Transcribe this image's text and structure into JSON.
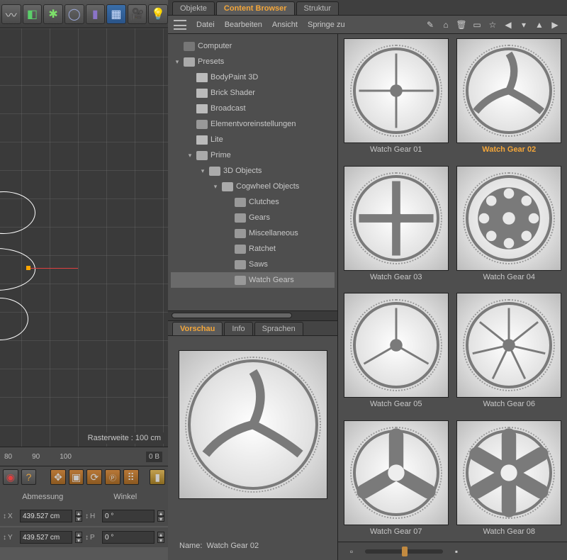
{
  "toolbar_icons": [
    "extrude",
    "cube",
    "flower",
    "shell",
    "deformer",
    "grid",
    "camera",
    "light"
  ],
  "viewport": {
    "raster_label": "Rasterweite : 100 cm"
  },
  "timeline": {
    "marks": [
      "80",
      "90",
      "100"
    ],
    "badge": "0 B"
  },
  "bottombar": {
    "header_dimension": "Abmessung",
    "header_angle": "Winkel",
    "x_label": "X",
    "x_val": "439.527 cm",
    "h_label": "H",
    "h_val": "0 °",
    "y_label": "Y",
    "y_val": "439.527 cm",
    "p_label": "P",
    "p_val": "0 °"
  },
  "panel": {
    "tabs": [
      "Objekte",
      "Content Browser",
      "Struktur"
    ],
    "active_tab": "Content Browser",
    "menu": [
      "Datei",
      "Bearbeiten",
      "Ansicht",
      "Springe zu"
    ],
    "right_icons": [
      "edit",
      "home",
      "trash",
      "book",
      "star",
      "back",
      "nav",
      "up",
      "fwd"
    ]
  },
  "tree": [
    {
      "depth": 0,
      "icon": "comp",
      "label": "Computer",
      "twisty": ""
    },
    {
      "depth": 0,
      "icon": "folder open",
      "label": "Presets",
      "twisty": "▾"
    },
    {
      "depth": 1,
      "icon": "doc",
      "label": "BodyPaint 3D",
      "twisty": ""
    },
    {
      "depth": 1,
      "icon": "doc",
      "label": "Brick Shader",
      "twisty": ""
    },
    {
      "depth": 1,
      "icon": "doc",
      "label": "Broadcast",
      "twisty": ""
    },
    {
      "depth": 1,
      "icon": "folder",
      "label": "Elementvoreinstellungen",
      "twisty": ""
    },
    {
      "depth": 1,
      "icon": "doc",
      "label": "Lite",
      "twisty": ""
    },
    {
      "depth": 1,
      "icon": "folder open",
      "label": "Prime",
      "twisty": "▾"
    },
    {
      "depth": 2,
      "icon": "folder open",
      "label": "3D Objects",
      "twisty": "▾"
    },
    {
      "depth": 3,
      "icon": "folder open",
      "label": "Cogwheel Objects",
      "twisty": "▾"
    },
    {
      "depth": 4,
      "icon": "folder",
      "label": "Clutches",
      "twisty": ""
    },
    {
      "depth": 4,
      "icon": "folder",
      "label": "Gears",
      "twisty": ""
    },
    {
      "depth": 4,
      "icon": "folder",
      "label": "Miscellaneous",
      "twisty": ""
    },
    {
      "depth": 4,
      "icon": "folder",
      "label": "Ratchet",
      "twisty": ""
    },
    {
      "depth": 4,
      "icon": "folder",
      "label": "Saws",
      "twisty": ""
    },
    {
      "depth": 4,
      "icon": "folder",
      "label": "Watch Gears",
      "twisty": "",
      "selected": true
    }
  ],
  "preview": {
    "tabs": [
      "Vorschau",
      "Info",
      "Sprachen"
    ],
    "active_tab": "Vorschau",
    "name_label": "Name:",
    "name_value": "Watch Gear 02"
  },
  "assets": [
    {
      "label": "Watch Gear 01",
      "spokes": 4,
      "style": "thin"
    },
    {
      "label": "Watch Gear 02",
      "spokes": 3,
      "style": "curved",
      "selected": true
    },
    {
      "label": "Watch Gear 03",
      "spokes": 4,
      "style": "thick"
    },
    {
      "label": "Watch Gear 04",
      "spokes": 8,
      "style": "cog"
    },
    {
      "label": "Watch Gear 05",
      "spokes": 3,
      "style": "thin"
    },
    {
      "label": "Watch Gear 06",
      "spokes": 7,
      "style": "thin"
    },
    {
      "label": "Watch Gear 07",
      "spokes": 3,
      "style": "tri"
    },
    {
      "label": "Watch Gear 08",
      "spokes": 6,
      "style": "tri"
    }
  ]
}
